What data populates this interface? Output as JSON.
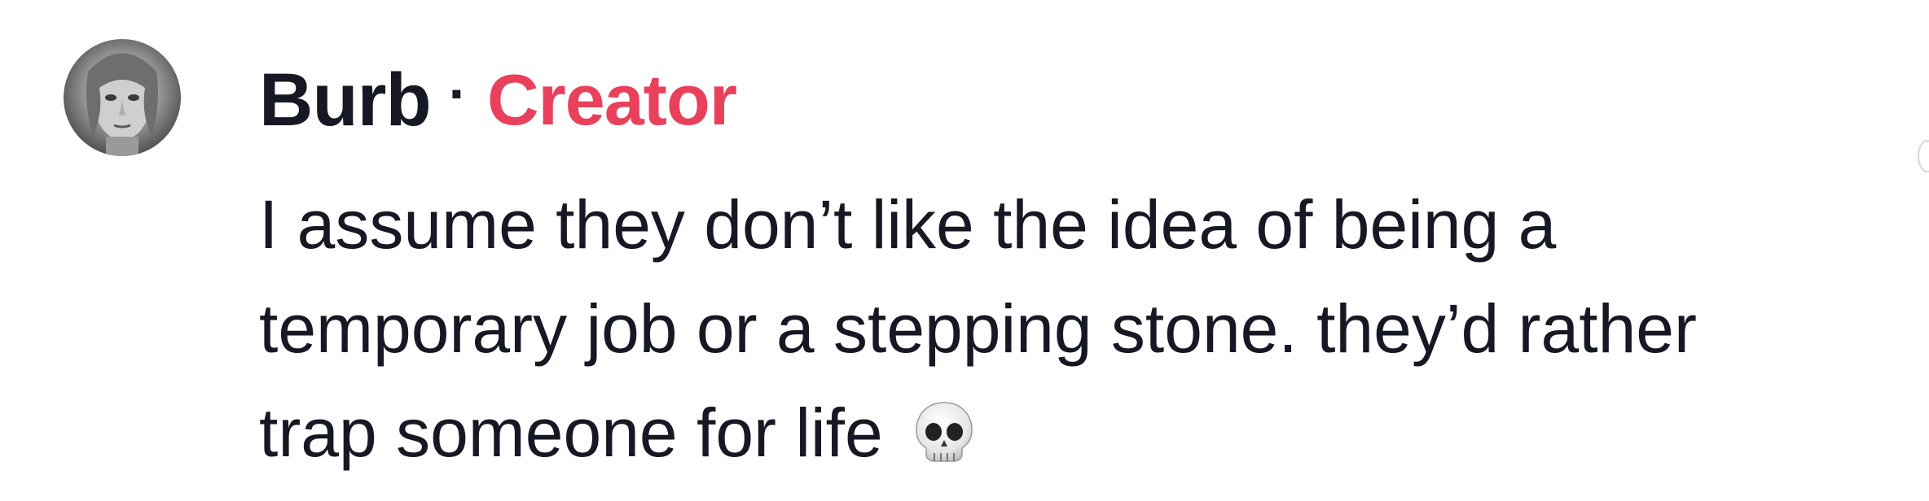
{
  "comment": {
    "username": "Burb",
    "separator": "·",
    "badge": "Creator",
    "text_lines": [
      "I assume they don’t like the idea of being a",
      "temporary job or a stepping stone. they’d rather",
      "trap someone for life"
    ],
    "emoji": "skull-emoji"
  },
  "colors": {
    "username": "#161823",
    "badge": "#e9415b",
    "text": "#161823",
    "background": "#ffffff"
  }
}
